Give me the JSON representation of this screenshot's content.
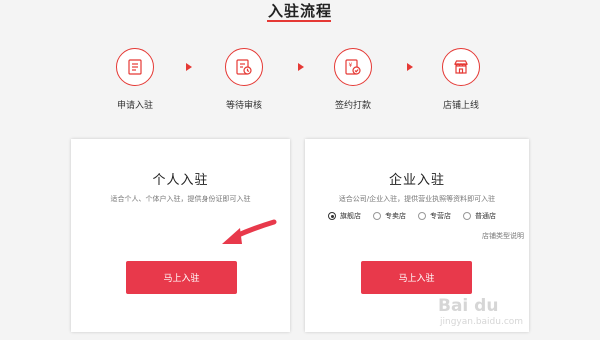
{
  "header": {
    "title": "入驻流程"
  },
  "steps": [
    {
      "label": "申请入驻",
      "icon": "document-form-icon"
    },
    {
      "label": "等待审核",
      "icon": "review-clock-icon"
    },
    {
      "label": "签约打款",
      "icon": "contract-payment-icon"
    },
    {
      "label": "店铺上线",
      "icon": "storefront-icon"
    }
  ],
  "personal": {
    "title": "个人入驻",
    "desc": "适合个人、个体户入驻，提供身份证即可入驻",
    "button": "马上入驻"
  },
  "enterprise": {
    "title": "企业入驻",
    "desc": "适合公司/企业入驻，提供营业执照等资料即可入驻",
    "store_types": [
      "旗舰店",
      "专卖店",
      "专营店",
      "普通店"
    ],
    "selected_store_type": "旗舰店",
    "store_type_link": "店铺类型说明",
    "button": "马上入驻"
  },
  "watermark": {
    "text": "Bai du",
    "sub": "jingyan.baidu.com"
  },
  "colors": {
    "accent": "#e53935",
    "button": "#e8394b",
    "background": "#f4f4f4"
  }
}
